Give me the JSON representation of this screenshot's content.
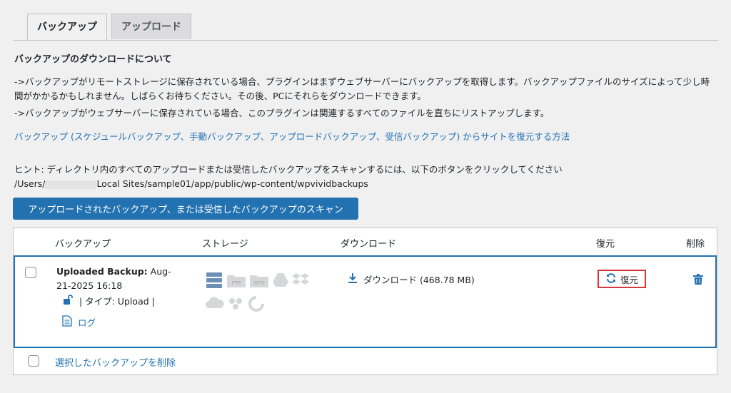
{
  "tabs": [
    {
      "label": "バックアップ",
      "active": true
    },
    {
      "label": "アップロード",
      "active": false
    }
  ],
  "section_title": "バックアップのダウンロードについて",
  "paragraphs": {
    "p1": "->バックアップがリモートストレージに保存されている場合、プラグインはまずウェブサーバーにバックアップを取得します。バックアップファイルのサイズによって少し時間がかかるかもしれません。しばらくお待ちください。その後、PCにそれらをダウンロードできます。",
    "p2": "->バックアップがウェブサーバーに保存されている場合、このプラグインは関連するすべてのファイルを直ちにリストアップします。",
    "restore_link": "バックアップ (スケジュールバックアップ、手動バックアップ、アップロードバックアップ、受信バックアップ) からサイトを復元する方法",
    "hint": "ヒント: ディレクトリ内のすべてのアップロードまたは受信したバックアップをスキャンするには、以下のボタンをクリックしてください",
    "path_prefix": "/Users/",
    "path_suffix": "Local Sites/sample01/app/public/wp-content/wpvividbackups"
  },
  "scan_button": "アップロードされたバックアップ、または受信したバックアップのスキャン",
  "table": {
    "headers": {
      "backup": "バックアップ",
      "storage": "ストレージ",
      "download": "ダウンロード",
      "restore": "復元",
      "delete": "削除"
    },
    "row": {
      "name_bold": "Uploaded Backup:",
      "date": "Aug-21-2025 16:18",
      "type": "| タイプ: Upload |",
      "log": "ログ",
      "download_label": "ダウンロード (468.78 MB)",
      "restore_label": "復元"
    },
    "delete_selected": "選択したバックアップを削除"
  },
  "storage_icons": [
    "server-icon",
    "ftp-icon",
    "sftp-icon",
    "google-drive-icon",
    "dropbox-icon",
    "onedrive-icon",
    "s3-icon",
    "backblaze-icon"
  ],
  "colors": {
    "accent": "#2271b1",
    "highlight": "#d63638"
  }
}
